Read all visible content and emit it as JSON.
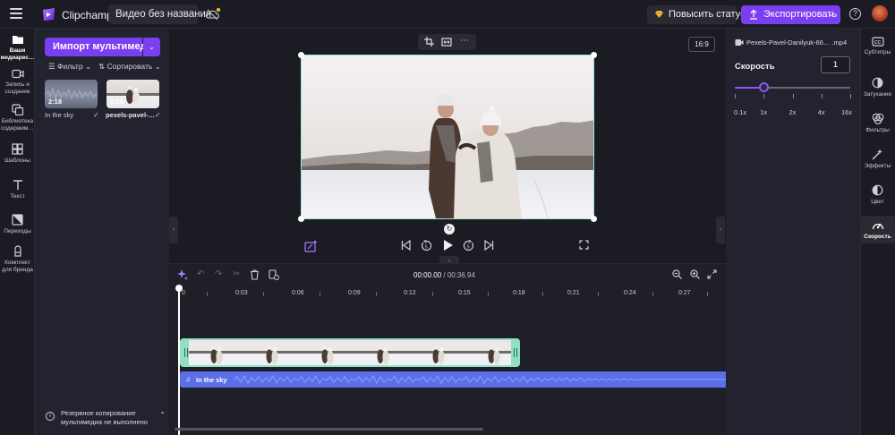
{
  "app": {
    "title": "Clipchamp",
    "project_name": "Видео без названия",
    "upgrade_label": "Повысить статус",
    "export_label": "Экспортировать",
    "help_glyph": "?"
  },
  "left_rail": [
    {
      "label": "Ваши медиарес…",
      "icon": "folder-icon"
    },
    {
      "label": "Запись и создание",
      "icon": "camera-icon"
    },
    {
      "label": "Библиотека содержим…",
      "icon": "library-icon"
    },
    {
      "label": "Шаблоны",
      "icon": "templates-icon"
    },
    {
      "label": "Текст",
      "icon": "text-icon"
    },
    {
      "label": "Переходы",
      "icon": "transitions-icon"
    },
    {
      "label": "Комплект для бренда",
      "icon": "brand-kit-icon"
    }
  ],
  "media_panel": {
    "import_label": "Импорт мультимедиа",
    "filter_label": "Фильтр",
    "sort_label": "Сортировать",
    "items": [
      {
        "name": "In the sky",
        "duration": "2:18",
        "check": "✓"
      },
      {
        "name": "pexels-pavel-…",
        "duration": "0:18",
        "check": "✓"
      }
    ],
    "backup_note": "Резервное копирование мультимедиа не выполнено"
  },
  "preview": {
    "aspect_ratio": "16:9"
  },
  "timeline": {
    "current_time": "00:00.00",
    "separator": " / ",
    "total_time": "00:36.94",
    "ticks": [
      "0",
      "0:03",
      "0:06",
      "0:09",
      "0:12",
      "0:15",
      "0:18",
      "0:21",
      "0:24",
      "0:27"
    ],
    "audio_clip_label": "In the sky"
  },
  "properties": {
    "file_name": "Pexels-Pavel-Danilyuk-66… .mp4",
    "speed_label": "Скорость",
    "speed_value": "1",
    "speed_fraction": 0.25,
    "speed_options": [
      "0.1x",
      "1x",
      "2x",
      "4x",
      "16x"
    ]
  },
  "right_rail": [
    {
      "label": "Субтитры",
      "icon": "captions-icon"
    },
    {
      "label": "Затухание",
      "icon": "fade-icon"
    },
    {
      "label": "Фильтры",
      "icon": "filters-icon"
    },
    {
      "label": "Эффекты",
      "icon": "effects-icon"
    },
    {
      "label": "Цвет",
      "icon": "color-icon"
    },
    {
      "label": "Скорость",
      "icon": "speed-icon"
    }
  ],
  "colors": {
    "accent": "#7b3ff2",
    "clip_border": "#8fe0c4",
    "audio_clip": "#5b6fe8"
  }
}
